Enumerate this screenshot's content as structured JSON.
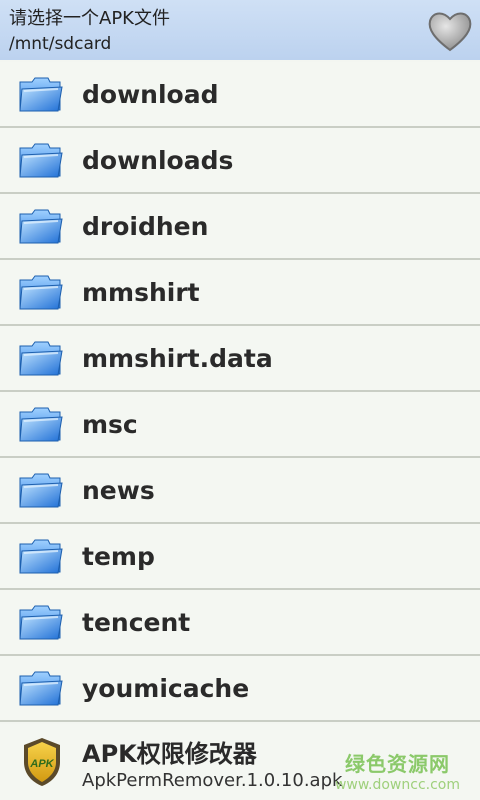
{
  "header": {
    "title": "请选择一个APK文件",
    "path": "/mnt/sdcard",
    "favorite_icon": "heart-icon"
  },
  "folders": [
    {
      "name": "download"
    },
    {
      "name": "downloads"
    },
    {
      "name": "droidhen"
    },
    {
      "name": "mmshirt"
    },
    {
      "name": "mmshirt.data"
    },
    {
      "name": "msc"
    },
    {
      "name": "news"
    },
    {
      "name": "temp"
    },
    {
      "name": "tencent"
    },
    {
      "name": "youmicache"
    }
  ],
  "apk": {
    "title": "APK权限修改器",
    "filename": "ApkPermRemover.1.0.10.apk",
    "badge_text": "APK"
  },
  "watermark": {
    "text": "绿色资源网",
    "url": "www.downcc.com"
  },
  "colors": {
    "header_bg": "#c6daf2",
    "row_bg": "#f4f7f2",
    "divider": "#c9cec5",
    "folder_blue": "#3a8ee8",
    "watermark_green": "#8bc96a"
  }
}
